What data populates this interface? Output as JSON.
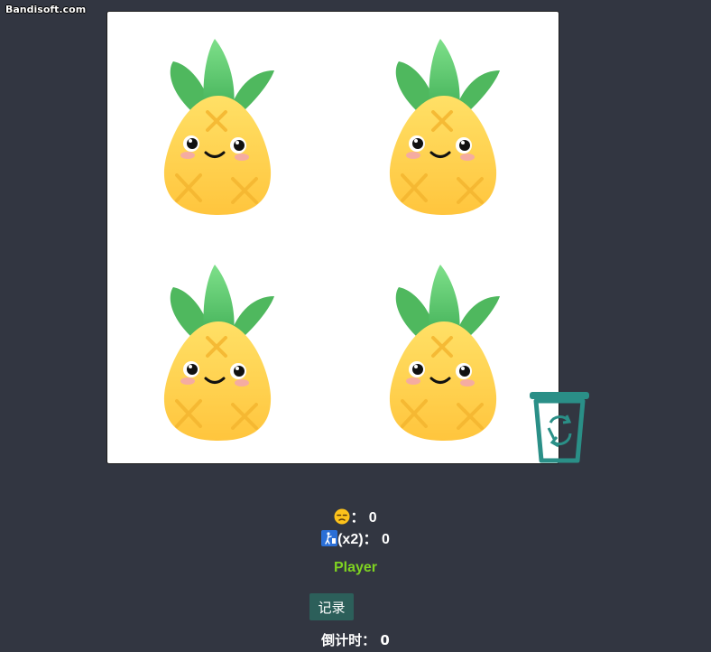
{
  "watermark": "Bandisoft.com",
  "board": {
    "tiles": [
      {
        "name": "pineapple"
      },
      {
        "name": "pineapple"
      },
      {
        "name": "pineapple"
      },
      {
        "name": "pineapple"
      }
    ]
  },
  "trash_icon": "recycle-trash-icon",
  "stats": {
    "sad_icon": "unamused-face-emoji",
    "sad_value": "： 0",
    "trash_icon": "litter-bin-emoji",
    "trash_label": "(x2)： 0"
  },
  "player": "Player",
  "record_button": "记录",
  "countdown": "倒计时： 0",
  "colors": {
    "background": "#323641",
    "board": "#ffffff",
    "player": "#7fd321",
    "button": "#2c5f5a",
    "trash": "#2a8f87"
  }
}
